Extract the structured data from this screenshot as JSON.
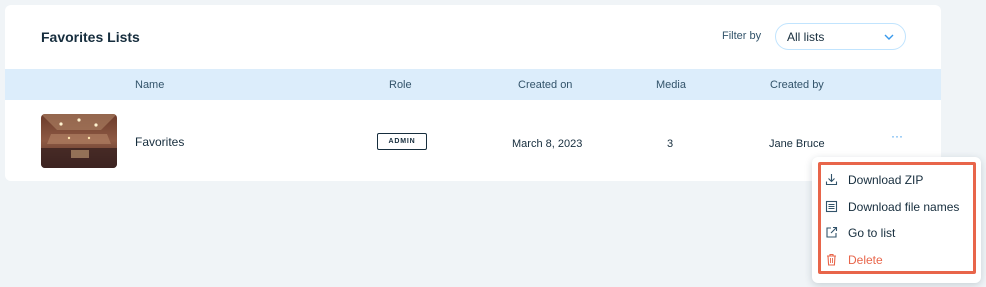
{
  "card": {
    "title": "Favorites Lists",
    "filter_label": "Filter by",
    "filter_value": "All lists"
  },
  "table": {
    "columns": [
      "Name",
      "Role",
      "Created on",
      "Media",
      "Created by"
    ],
    "rows": [
      {
        "name": "Favorites",
        "role": "ADMIN",
        "created_on": "March 8, 2023",
        "media": "3",
        "created_by": "Jane Bruce",
        "more": "···"
      }
    ]
  },
  "menu": {
    "items": [
      {
        "label": "Download ZIP",
        "icon": "download-icon"
      },
      {
        "label": "Download file names",
        "icon": "list-icon"
      },
      {
        "label": "Go to list",
        "icon": "external-link-icon"
      },
      {
        "label": "Delete",
        "icon": "trash-icon",
        "color": "#e8654a"
      }
    ]
  },
  "colors": {
    "page_bg": "#f0f4f7",
    "header_bg": "#dcedfb",
    "accent": "#3899ec",
    "danger": "#e8654a",
    "highlight_border": "#e8654a"
  }
}
